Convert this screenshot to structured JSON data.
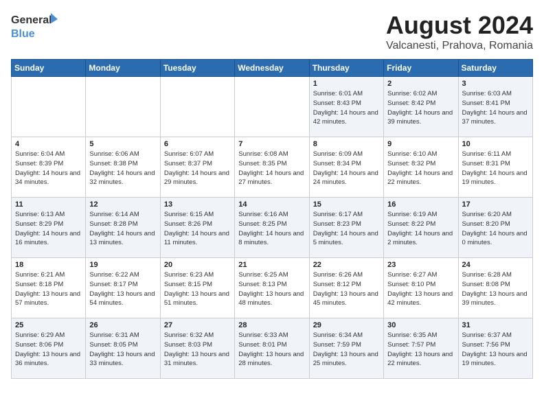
{
  "logo": {
    "line1": "General",
    "line2": "Blue"
  },
  "title": {
    "month_year": "August 2024",
    "location": "Valcanesti, Prahova, Romania"
  },
  "days_of_week": [
    "Sunday",
    "Monday",
    "Tuesday",
    "Wednesday",
    "Thursday",
    "Friday",
    "Saturday"
  ],
  "weeks": [
    [
      {
        "day": "",
        "info": ""
      },
      {
        "day": "",
        "info": ""
      },
      {
        "day": "",
        "info": ""
      },
      {
        "day": "",
        "info": ""
      },
      {
        "day": "1",
        "info": "Sunrise: 6:01 AM\nSunset: 8:43 PM\nDaylight: 14 hours and 42 minutes."
      },
      {
        "day": "2",
        "info": "Sunrise: 6:02 AM\nSunset: 8:42 PM\nDaylight: 14 hours and 39 minutes."
      },
      {
        "day": "3",
        "info": "Sunrise: 6:03 AM\nSunset: 8:41 PM\nDaylight: 14 hours and 37 minutes."
      }
    ],
    [
      {
        "day": "4",
        "info": "Sunrise: 6:04 AM\nSunset: 8:39 PM\nDaylight: 14 hours and 34 minutes."
      },
      {
        "day": "5",
        "info": "Sunrise: 6:06 AM\nSunset: 8:38 PM\nDaylight: 14 hours and 32 minutes."
      },
      {
        "day": "6",
        "info": "Sunrise: 6:07 AM\nSunset: 8:37 PM\nDaylight: 14 hours and 29 minutes."
      },
      {
        "day": "7",
        "info": "Sunrise: 6:08 AM\nSunset: 8:35 PM\nDaylight: 14 hours and 27 minutes."
      },
      {
        "day": "8",
        "info": "Sunrise: 6:09 AM\nSunset: 8:34 PM\nDaylight: 14 hours and 24 minutes."
      },
      {
        "day": "9",
        "info": "Sunrise: 6:10 AM\nSunset: 8:32 PM\nDaylight: 14 hours and 22 minutes."
      },
      {
        "day": "10",
        "info": "Sunrise: 6:11 AM\nSunset: 8:31 PM\nDaylight: 14 hours and 19 minutes."
      }
    ],
    [
      {
        "day": "11",
        "info": "Sunrise: 6:13 AM\nSunset: 8:29 PM\nDaylight: 14 hours and 16 minutes."
      },
      {
        "day": "12",
        "info": "Sunrise: 6:14 AM\nSunset: 8:28 PM\nDaylight: 14 hours and 13 minutes."
      },
      {
        "day": "13",
        "info": "Sunrise: 6:15 AM\nSunset: 8:26 PM\nDaylight: 14 hours and 11 minutes."
      },
      {
        "day": "14",
        "info": "Sunrise: 6:16 AM\nSunset: 8:25 PM\nDaylight: 14 hours and 8 minutes."
      },
      {
        "day": "15",
        "info": "Sunrise: 6:17 AM\nSunset: 8:23 PM\nDaylight: 14 hours and 5 minutes."
      },
      {
        "day": "16",
        "info": "Sunrise: 6:19 AM\nSunset: 8:22 PM\nDaylight: 14 hours and 2 minutes."
      },
      {
        "day": "17",
        "info": "Sunrise: 6:20 AM\nSunset: 8:20 PM\nDaylight: 14 hours and 0 minutes."
      }
    ],
    [
      {
        "day": "18",
        "info": "Sunrise: 6:21 AM\nSunset: 8:18 PM\nDaylight: 13 hours and 57 minutes."
      },
      {
        "day": "19",
        "info": "Sunrise: 6:22 AM\nSunset: 8:17 PM\nDaylight: 13 hours and 54 minutes."
      },
      {
        "day": "20",
        "info": "Sunrise: 6:23 AM\nSunset: 8:15 PM\nDaylight: 13 hours and 51 minutes."
      },
      {
        "day": "21",
        "info": "Sunrise: 6:25 AM\nSunset: 8:13 PM\nDaylight: 13 hours and 48 minutes."
      },
      {
        "day": "22",
        "info": "Sunrise: 6:26 AM\nSunset: 8:12 PM\nDaylight: 13 hours and 45 minutes."
      },
      {
        "day": "23",
        "info": "Sunrise: 6:27 AM\nSunset: 8:10 PM\nDaylight: 13 hours and 42 minutes."
      },
      {
        "day": "24",
        "info": "Sunrise: 6:28 AM\nSunset: 8:08 PM\nDaylight: 13 hours and 39 minutes."
      }
    ],
    [
      {
        "day": "25",
        "info": "Sunrise: 6:29 AM\nSunset: 8:06 PM\nDaylight: 13 hours and 36 minutes."
      },
      {
        "day": "26",
        "info": "Sunrise: 6:31 AM\nSunset: 8:05 PM\nDaylight: 13 hours and 33 minutes."
      },
      {
        "day": "27",
        "info": "Sunrise: 6:32 AM\nSunset: 8:03 PM\nDaylight: 13 hours and 31 minutes."
      },
      {
        "day": "28",
        "info": "Sunrise: 6:33 AM\nSunset: 8:01 PM\nDaylight: 13 hours and 28 minutes."
      },
      {
        "day": "29",
        "info": "Sunrise: 6:34 AM\nSunset: 7:59 PM\nDaylight: 13 hours and 25 minutes."
      },
      {
        "day": "30",
        "info": "Sunrise: 6:35 AM\nSunset: 7:57 PM\nDaylight: 13 hours and 22 minutes."
      },
      {
        "day": "31",
        "info": "Sunrise: 6:37 AM\nSunset: 7:56 PM\nDaylight: 13 hours and 19 minutes."
      }
    ]
  ]
}
